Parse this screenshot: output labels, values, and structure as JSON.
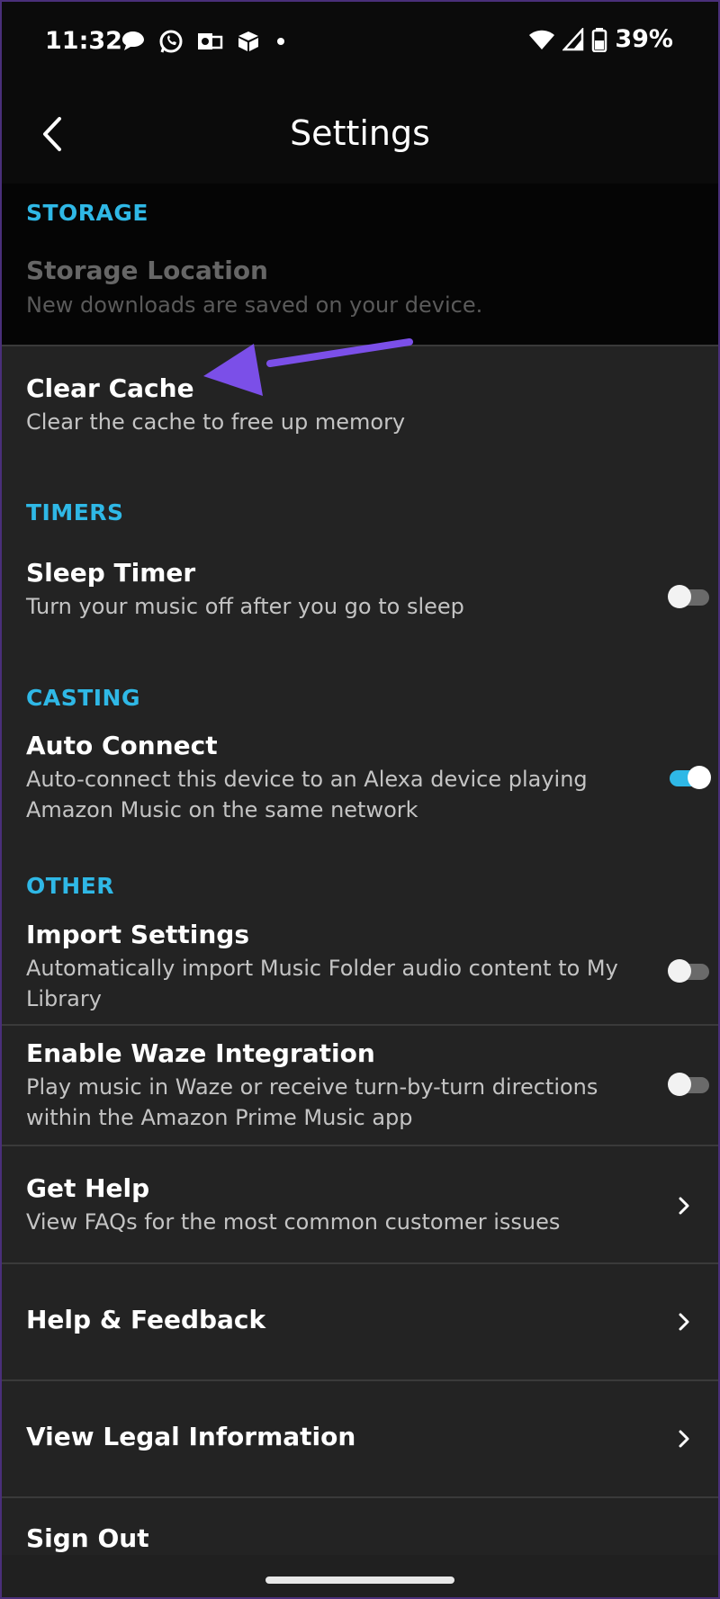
{
  "status_bar": {
    "time": "11:32",
    "battery": "39%",
    "notification_icons": [
      "chat-bubble-icon",
      "whatsapp-icon",
      "outlook-icon",
      "box-app-icon",
      "dot-icon"
    ]
  },
  "header": {
    "title": "Settings",
    "back_icon": "chevron-left-icon"
  },
  "colors": {
    "accent": "#2fb8e6",
    "annotation_arrow": "#7b4fe8",
    "background": "#232323"
  },
  "sections": {
    "storage": {
      "title": "STORAGE",
      "storage_location": {
        "title": "Storage Location",
        "subtitle": "New downloads are saved on your device."
      },
      "clear_cache": {
        "title": "Clear Cache",
        "subtitle": "Clear the cache to free up memory"
      }
    },
    "timers": {
      "title": "TIMERS",
      "sleep_timer": {
        "title": "Sleep Timer",
        "subtitle": "Turn your music off after you go to sleep",
        "enabled": false
      }
    },
    "casting": {
      "title": "CASTING",
      "auto_connect": {
        "title": "Auto Connect",
        "subtitle": "Auto-connect this device to an Alexa device playing Amazon Music on the same network",
        "enabled": true
      }
    },
    "other": {
      "title": "OTHER",
      "import_settings": {
        "title": "Import Settings",
        "subtitle": "Automatically import Music Folder audio content to My Library",
        "enabled": false
      },
      "waze": {
        "title": "Enable Waze Integration",
        "subtitle": "Play music in Waze or receive turn-by-turn directions within the Amazon Prime Music app",
        "enabled": false
      },
      "get_help": {
        "title": "Get Help",
        "subtitle": "View FAQs for the most common customer issues"
      },
      "help_feedback": {
        "title": "Help & Feedback"
      },
      "legal": {
        "title": "View Legal Information"
      },
      "sign_out": {
        "title": "Sign Out"
      }
    }
  }
}
